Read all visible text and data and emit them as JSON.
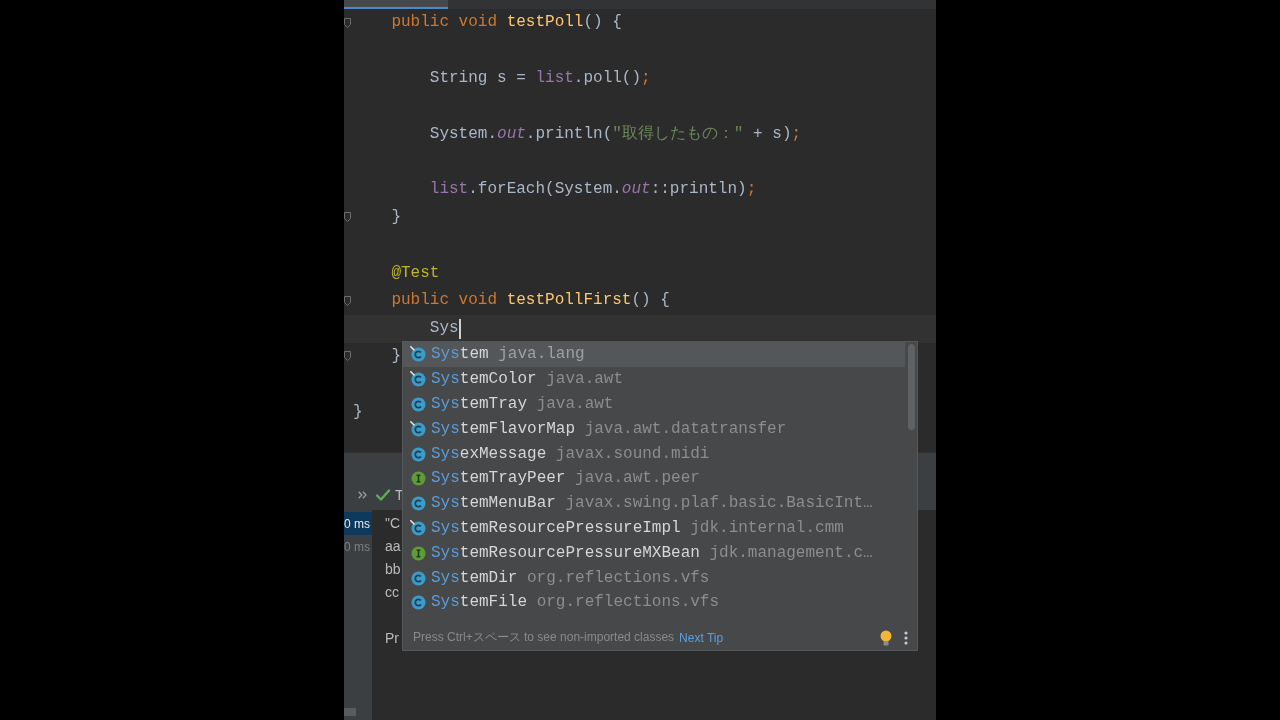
{
  "editor": {
    "lines": [
      {
        "kind": "code",
        "current": false,
        "fold_marker": true,
        "tokens": [
          {
            "text": "    public void ",
            "kind": "keyword"
          },
          {
            "text": "testPoll",
            "kind": "method"
          },
          {
            "text": "() {",
            "kind": "plain"
          }
        ]
      },
      {
        "kind": "blank",
        "current": false,
        "fold_marker": false
      },
      {
        "kind": "code",
        "current": false,
        "fold_marker": false,
        "tokens": [
          {
            "text": "        String s = ",
            "kind": "plain"
          },
          {
            "text": "list",
            "kind": "field"
          },
          {
            "text": ".poll()",
            "kind": "plain"
          },
          {
            "text": ";",
            "kind": "punct"
          }
        ]
      },
      {
        "kind": "blank",
        "current": false,
        "fold_marker": false
      },
      {
        "kind": "code",
        "current": false,
        "fold_marker": false,
        "tokens": [
          {
            "text": "        System.",
            "kind": "plain"
          },
          {
            "text": "out",
            "kind": "static_field"
          },
          {
            "text": ".println(",
            "kind": "plain"
          },
          {
            "text": "\"取得したもの：\"",
            "kind": "string"
          },
          {
            "text": " + s)",
            "kind": "plain"
          },
          {
            "text": ";",
            "kind": "punct"
          }
        ]
      },
      {
        "kind": "blank",
        "current": false,
        "fold_marker": false
      },
      {
        "kind": "code",
        "current": false,
        "fold_marker": false,
        "tokens": [
          {
            "text": "        list",
            "kind": "field"
          },
          {
            "text": ".forEach(System.",
            "kind": "plain"
          },
          {
            "text": "out",
            "kind": "static_field"
          },
          {
            "text": "::println)",
            "kind": "plain"
          },
          {
            "text": ";",
            "kind": "punct"
          }
        ]
      },
      {
        "kind": "code",
        "current": false,
        "fold_marker": true,
        "tokens": [
          {
            "text": "    }",
            "kind": "plain"
          }
        ]
      },
      {
        "kind": "blank",
        "current": false,
        "fold_marker": false
      },
      {
        "kind": "code",
        "current": false,
        "fold_marker": false,
        "tokens": [
          {
            "text": "    @Test",
            "kind": "annotation"
          }
        ]
      },
      {
        "kind": "code",
        "current": false,
        "fold_marker": true,
        "tokens": [
          {
            "text": "    public void ",
            "kind": "keyword"
          },
          {
            "text": "testPollFirst",
            "kind": "method"
          },
          {
            "text": "() {",
            "kind": "plain"
          }
        ]
      },
      {
        "kind": "code",
        "current": true,
        "fold_marker": false,
        "tokens": [
          {
            "text": "        Sys",
            "kind": "plain"
          }
        ]
      },
      {
        "kind": "code",
        "current": false,
        "fold_marker": true,
        "tokens": [
          {
            "text": "    }",
            "kind": "plain"
          }
        ]
      },
      {
        "kind": "blank",
        "current": false,
        "fold_marker": false
      },
      {
        "kind": "code",
        "current": false,
        "fold_marker": false,
        "tokens": [
          {
            "text": "}",
            "kind": "plain"
          }
        ]
      }
    ]
  },
  "tool_window": {
    "toolbar_label": "T",
    "durations": [
      {
        "text": "0 ms",
        "selected": true
      },
      {
        "text": "0 ms",
        "selected": false
      }
    ],
    "console": [
      {
        "kind": "text",
        "text": "\"C"
      },
      {
        "kind": "text",
        "text": "aa"
      },
      {
        "kind": "text",
        "text": "bb"
      },
      {
        "kind": "text",
        "text": "cc"
      },
      {
        "kind": "blank"
      },
      {
        "kind": "text",
        "text": "Pr"
      }
    ]
  },
  "completion_popup": {
    "items": [
      {
        "kind": "class",
        "corner_mark": true,
        "selected": true,
        "match": "Sys",
        "rest": "tem",
        "package": "java.lang"
      },
      {
        "kind": "class",
        "corner_mark": true,
        "selected": false,
        "match": "Sys",
        "rest": "temColor",
        "package": "java.awt"
      },
      {
        "kind": "class",
        "corner_mark": false,
        "selected": false,
        "match": "Sys",
        "rest": "temTray",
        "package": "java.awt"
      },
      {
        "kind": "class",
        "corner_mark": true,
        "selected": false,
        "match": "Sys",
        "rest": "temFlavorMap",
        "package": "java.awt.datatransfer"
      },
      {
        "kind": "class",
        "corner_mark": false,
        "selected": false,
        "match": "Sys",
        "rest": "exMessage",
        "package": "javax.sound.midi"
      },
      {
        "kind": "interface",
        "corner_mark": false,
        "selected": false,
        "match": "Sys",
        "rest": "temTrayPeer",
        "package": "java.awt.peer"
      },
      {
        "kind": "class",
        "corner_mark": false,
        "selected": false,
        "match": "Sys",
        "rest": "temMenuBar",
        "package": "javax.swing.plaf.basic.BasicInt…"
      },
      {
        "kind": "class",
        "corner_mark": true,
        "selected": false,
        "match": "Sys",
        "rest": "temResourcePressureImpl",
        "package": "jdk.internal.cmm"
      },
      {
        "kind": "interface",
        "corner_mark": false,
        "selected": false,
        "match": "Sys",
        "rest": "temResourcePressureMXBean",
        "package": "jdk.management.c…"
      },
      {
        "kind": "class",
        "corner_mark": false,
        "selected": false,
        "match": "Sys",
        "rest": "temDir",
        "package": "org.reflections.vfs"
      },
      {
        "kind": "class",
        "corner_mark": false,
        "selected": false,
        "match": "Sys",
        "rest": "temFile",
        "package": "org.reflections.vfs"
      }
    ],
    "footer": {
      "hint": "Press Ctrl+スペース to see non-imported classes",
      "link": "Next Tip"
    }
  }
}
